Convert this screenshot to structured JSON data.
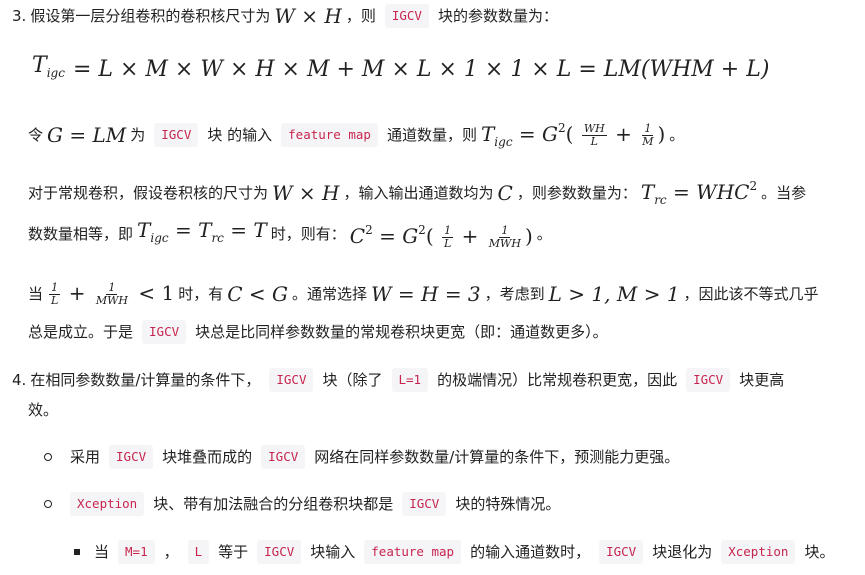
{
  "item3": {
    "number": "3.",
    "line1_text_a": "假设第一层分组卷积的卷积核尺寸为",
    "line1_math": "W × H",
    "line1_text_b": "，则",
    "line1_code": "IGCV",
    "line1_text_c": "块的参数数量为：",
    "formula_main": "= L × M × W × H × M + M × L × 1 × 1 × L = LM(WHM + L)",
    "line3_text_a": "令",
    "line3_math": "G = LM",
    "line3_text_b": "为",
    "line3_code1": "IGCV",
    "line3_text_c": "块 的输入",
    "line3_code2": "feature map",
    "line3_text_d": "通道数量，则",
    "line3_formula_eq": "=",
    "line3_end": "。",
    "line4_text_a": "对于常规卷积，假设卷积核的尺寸为",
    "line4_math1": "W × H",
    "line4_text_b": "，输入输出通道数均为",
    "line4_math2": "C",
    "line4_text_c": "，则参数数量为：",
    "line4_formula": "= WHC",
    "line4_text_d": "。当参",
    "line5_text_a": "数数量相等，即",
    "line5_text_b": "时，则有：",
    "line5_end": "。",
    "line6_text_a": "当",
    "line6_math": "< 1",
    "line6_text_b": "时，有",
    "line6_math2": "C < G",
    "line6_text_c": "。通常选择",
    "line6_math3": "W = H = 3",
    "line6_text_d": "，考虑到",
    "line6_math4": "L > 1, M > 1",
    "line6_text_e": "，因此该不等式几乎",
    "line7_text_a": "总是成立。于是",
    "line7_code": "IGCV",
    "line7_text_b": "块总是比同样参数数量的常规卷积块更宽（即：通道数更多）。"
  },
  "item4": {
    "number": "4.",
    "line1_text_a": "在相同参数数量/计算量的条件下，",
    "line1_code1": "IGCV",
    "line1_text_b": "块（除了",
    "line1_code2": "L=1",
    "line1_text_c": "的极端情况）比常规卷积更宽，因此",
    "line1_code3": "IGCV",
    "line1_text_d": "块更高",
    "line2_text": "效。",
    "bullet1_text_a": "采用",
    "bullet1_code1": "IGCV",
    "bullet1_text_b": "块堆叠而成的",
    "bullet1_code2": "IGCV",
    "bullet1_text_c": "网络在同样参数数量/计算量的条件下，预测能力更强。",
    "bullet2_code1": "Xception",
    "bullet2_text_a": "块、带有加法融合的分组卷积块都是",
    "bullet2_code2": "IGCV",
    "bullet2_text_b": "块的特殊情况。",
    "sub_text_a": "当",
    "sub_code1": "M=1",
    "sub_text_b": "，",
    "sub_code2": "L",
    "sub_text_c": "等于",
    "sub_code3": "IGCV",
    "sub_text_d": "块输入",
    "sub_code4": "feature map",
    "sub_text_e": "的输入通道数时，",
    "sub_code5": "IGCV",
    "sub_text_f": "块退化为",
    "sub_code6": "Xception",
    "sub_text_g": "块。"
  },
  "symbols": {
    "T": "T",
    "igc": "igc",
    "rc": "rc",
    "G": "G",
    "C": "C",
    "two": "2",
    "paren_open": "(",
    "paren_close": ")",
    "plus": "+",
    "eq": "=",
    "T_plain": "= T",
    "frac_wh_num": "WH",
    "frac_wh_den": "L",
    "frac_1m_num": "1",
    "frac_1m_den": "M",
    "frac_1l_num": "1",
    "frac_1l_den": "L",
    "frac_mwh_num": "1",
    "frac_mwh_den": "MWH"
  }
}
